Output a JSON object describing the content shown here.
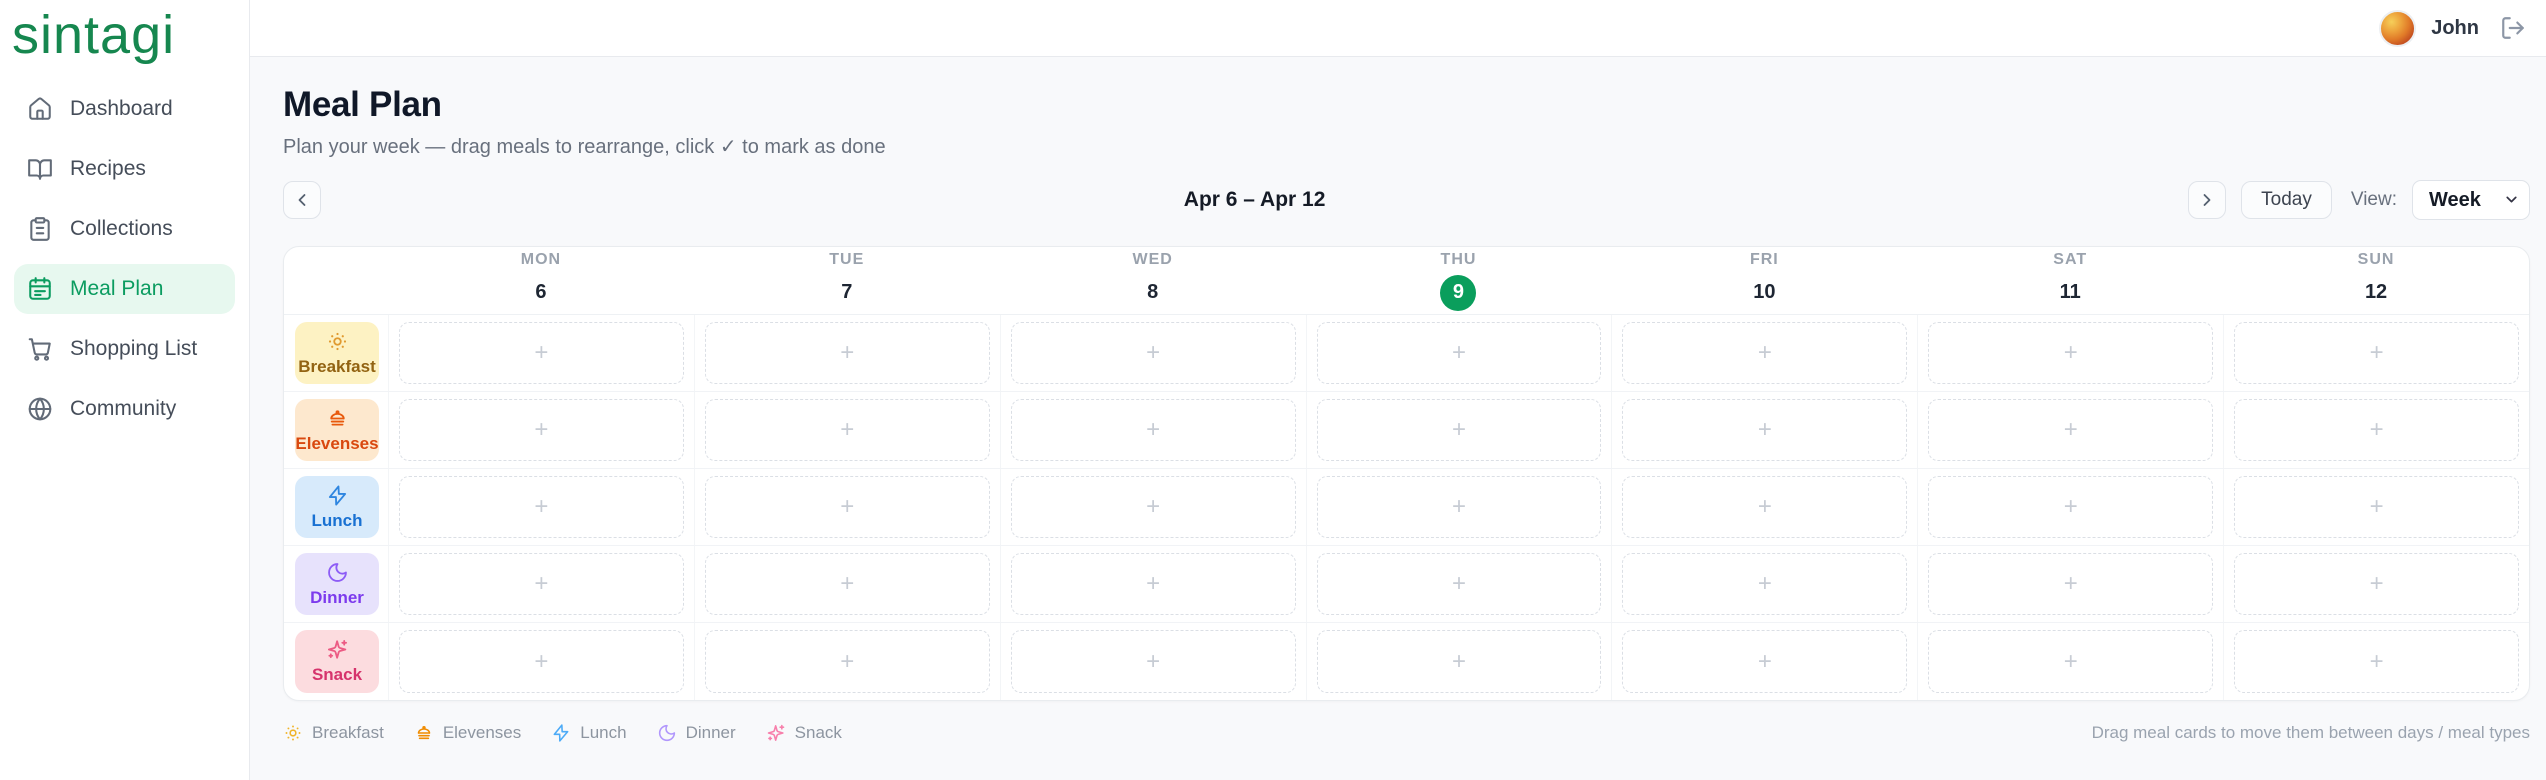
{
  "brand": {
    "logo_text": "sintagi",
    "color": "#16874f"
  },
  "topbar": {
    "user_name": "John"
  },
  "sidebar": {
    "items": [
      {
        "label": "Dashboard",
        "icon": "home-icon",
        "active": false
      },
      {
        "label": "Recipes",
        "icon": "book-open-icon",
        "active": false
      },
      {
        "label": "Collections",
        "icon": "clipboard-icon",
        "active": false
      },
      {
        "label": "Meal Plan",
        "icon": "calendar-icon",
        "active": true
      },
      {
        "label": "Shopping List",
        "icon": "cart-icon",
        "active": false
      },
      {
        "label": "Community",
        "icon": "globe-icon",
        "active": false
      }
    ]
  },
  "page": {
    "title": "Meal Plan",
    "subtitle": "Plan your week — drag meals to rearrange, click ✓ to mark as done"
  },
  "week_nav": {
    "range": "Apr 6 – Apr 12",
    "today_label": "Today",
    "view_label": "View:",
    "view_value": "Week"
  },
  "calendar": {
    "plus": "+",
    "today_color": "#0a9e5c",
    "days": [
      {
        "abbr": "MON",
        "date": "6",
        "is_today": false
      },
      {
        "abbr": "TUE",
        "date": "7",
        "is_today": false
      },
      {
        "abbr": "WED",
        "date": "8",
        "is_today": false
      },
      {
        "abbr": "THU",
        "date": "9",
        "is_today": true
      },
      {
        "abbr": "FRI",
        "date": "10",
        "is_today": false
      },
      {
        "abbr": "SAT",
        "date": "11",
        "is_today": false
      },
      {
        "abbr": "SUN",
        "date": "12",
        "is_today": false
      }
    ],
    "meal_types": [
      {
        "label": "Breakfast",
        "icon": "sun-icon",
        "bg": "#fdf2c3",
        "fg": "#926312",
        "icon_color": "#e09a2f"
      },
      {
        "label": "Elevenses",
        "icon": "steamer-icon",
        "bg": "#fde8ce",
        "fg": "#d9480f",
        "icon_color": "#e8590c"
      },
      {
        "label": "Lunch",
        "icon": "bolt-icon",
        "bg": "#d7eafb",
        "fg": "#1971d2",
        "icon_color": "#2f86e0"
      },
      {
        "label": "Dinner",
        "icon": "moon-icon",
        "bg": "#e7e2fc",
        "fg": "#7c3aed",
        "icon_color": "#8d5cf6"
      },
      {
        "label": "Snack",
        "icon": "sparkles-icon",
        "bg": "#fcdcdf",
        "fg": "#d6336c",
        "icon_color": "#ec5b84"
      }
    ]
  },
  "footer": {
    "legend": [
      {
        "label": "Breakfast",
        "icon": "sun-icon",
        "icon_color": "#f0b429"
      },
      {
        "label": "Elevenses",
        "icon": "steamer-icon",
        "icon_color": "#f08c00"
      },
      {
        "label": "Lunch",
        "icon": "bolt-icon",
        "icon_color": "#4dabf7"
      },
      {
        "label": "Dinner",
        "icon": "moon-icon",
        "icon_color": "#b197fc"
      },
      {
        "label": "Snack",
        "icon": "sparkles-icon",
        "icon_color": "#f77fab"
      }
    ],
    "hint": "Drag meal cards to move them between days / meal types"
  }
}
